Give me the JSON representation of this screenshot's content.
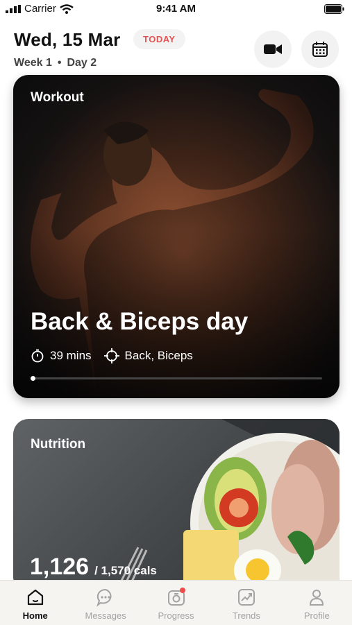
{
  "status_bar": {
    "carrier": "Carrier",
    "time": "9:41 AM"
  },
  "header": {
    "date": "Wed, 15 Mar",
    "today_label": "TODAY",
    "week": "Week 1",
    "separator": "•",
    "day": "Day 2"
  },
  "workout": {
    "label": "Workout",
    "title": "Back & Biceps day",
    "duration": "39 mins",
    "target": "Back, Biceps",
    "progress": 0.02
  },
  "nutrition": {
    "label": "Nutrition",
    "calories": "1,126",
    "goal": "/ 1,570 cals"
  },
  "tabs": [
    {
      "label": "Home",
      "icon": "home-icon",
      "active": true
    },
    {
      "label": "Messages",
      "icon": "messages-icon"
    },
    {
      "label": "Progress",
      "icon": "camera-icon",
      "badge": true
    },
    {
      "label": "Trends",
      "icon": "trend-icon"
    },
    {
      "label": "Profile",
      "icon": "profile-icon"
    }
  ],
  "colors": {
    "accent": "#e05555",
    "tab_inactive": "#a3a3a3",
    "badge": "#f04a4a"
  }
}
